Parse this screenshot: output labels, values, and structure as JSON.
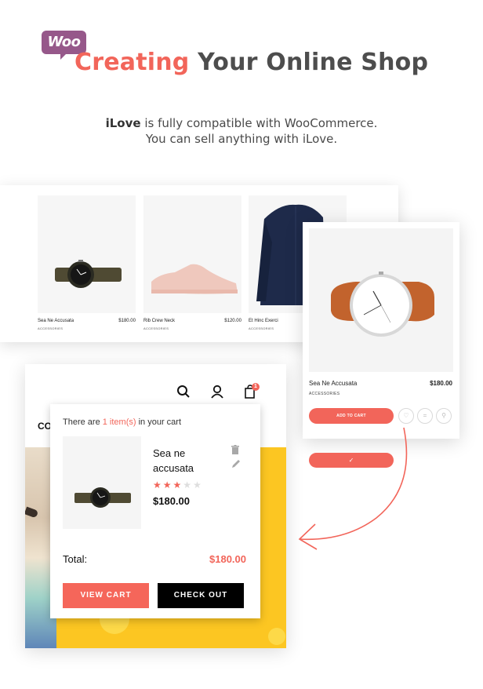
{
  "header": {
    "badge": "Woo",
    "title_accent": "Creating",
    "title_rest": " Your Online Shop",
    "subtitle_brand": "iLove",
    "subtitle_line1_rest": " is fully compatible with WooCommerce.",
    "subtitle_line2": "You can sell anything with iLove."
  },
  "strip": {
    "products": [
      {
        "name": "Sea Ne Accusata",
        "price": "$180.00",
        "category": "ACCESSORIES",
        "image": "watch-dark-icon"
      },
      {
        "name": "Rib Crew Neck",
        "price": "$120.00",
        "category": "ACCESSORIES",
        "image": "sneaker-icon"
      },
      {
        "name": "Et Hinc Exerci",
        "price": "",
        "category": "ACCESSORIES",
        "image": "shirt-icon"
      }
    ]
  },
  "feature": {
    "name": "Sea Ne Accusata",
    "price": "$180.00",
    "category": "ACCESSORIES",
    "add_to_cart": "ADD TO CART",
    "added_check": "✓",
    "wishlist_icon": "♡",
    "compare_icon": "=",
    "quickview_icon": "⚲"
  },
  "site": {
    "brand": "CO",
    "cart_count": "1"
  },
  "minicart": {
    "head_prefix": "There are ",
    "head_count": "1 item(s)",
    "head_suffix": " in your cart",
    "item_name": "Sea ne accusata",
    "item_price": "$180.00",
    "rating": 3,
    "rating_max": 5,
    "total_label": "Total:",
    "total_value": "$180.00",
    "view_cart": "VIEW CART",
    "check_out": "CHECK OUT"
  },
  "colors": {
    "accent": "#f2655a",
    "woo": "#96588a",
    "hero": "#fcc622"
  }
}
